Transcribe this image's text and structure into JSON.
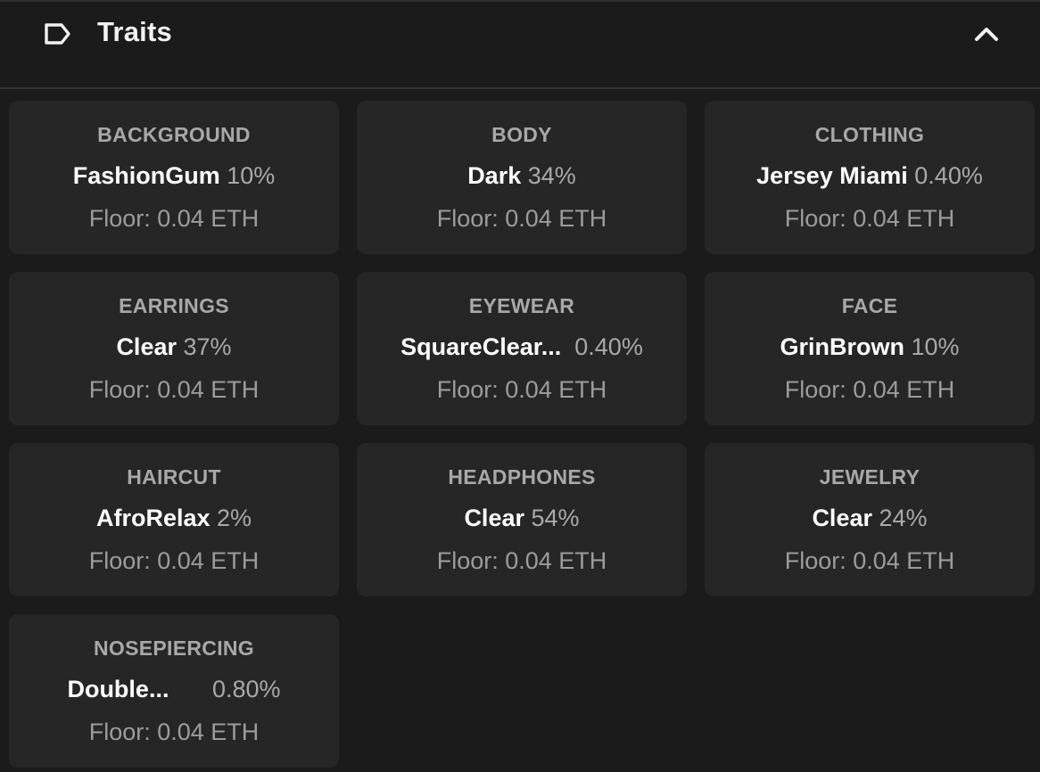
{
  "header": {
    "title": "Traits",
    "icon": "tag-icon",
    "collapse_icon": "chevron-up-icon"
  },
  "traits": [
    {
      "type": "BACKGROUND",
      "value": "FashionGum",
      "percent": "10%",
      "floor": "Floor: 0.04 ETH"
    },
    {
      "type": "BODY",
      "value": "Dark",
      "percent": "34%",
      "floor": "Floor: 0.04 ETH"
    },
    {
      "type": "CLOTHING",
      "value": "Jersey Miami",
      "percent": "0.40%",
      "floor": "Floor: 0.04 ETH"
    },
    {
      "type": "EARRINGS",
      "value": "Clear",
      "percent": "37%",
      "floor": "Floor: 0.04 ETH"
    },
    {
      "type": "EYEWEAR",
      "value": "SquareClear...",
      "percent": "0.40%",
      "floor": "Floor: 0.04 ETH"
    },
    {
      "type": "FACE",
      "value": "GrinBrown",
      "percent": "10%",
      "floor": "Floor: 0.04 ETH"
    },
    {
      "type": "HAIRCUT",
      "value": "AfroRelax",
      "percent": "2%",
      "floor": "Floor: 0.04 ETH"
    },
    {
      "type": "HEADPHONES",
      "value": "Clear",
      "percent": "54%",
      "floor": "Floor: 0.04 ETH"
    },
    {
      "type": "JEWELRY",
      "value": "Clear",
      "percent": "24%",
      "floor": "Floor: 0.04 ETH"
    },
    {
      "type": "NOSEPIERCING",
      "value": "Double...",
      "percent": "0.80%",
      "floor": "Floor: 0.04 ETH"
    }
  ],
  "colors": {
    "background": "#1b1b1b",
    "card": "#262626",
    "type_label": "#a8a8a8",
    "value": "#ffffff",
    "muted": "#9c9c9c"
  }
}
